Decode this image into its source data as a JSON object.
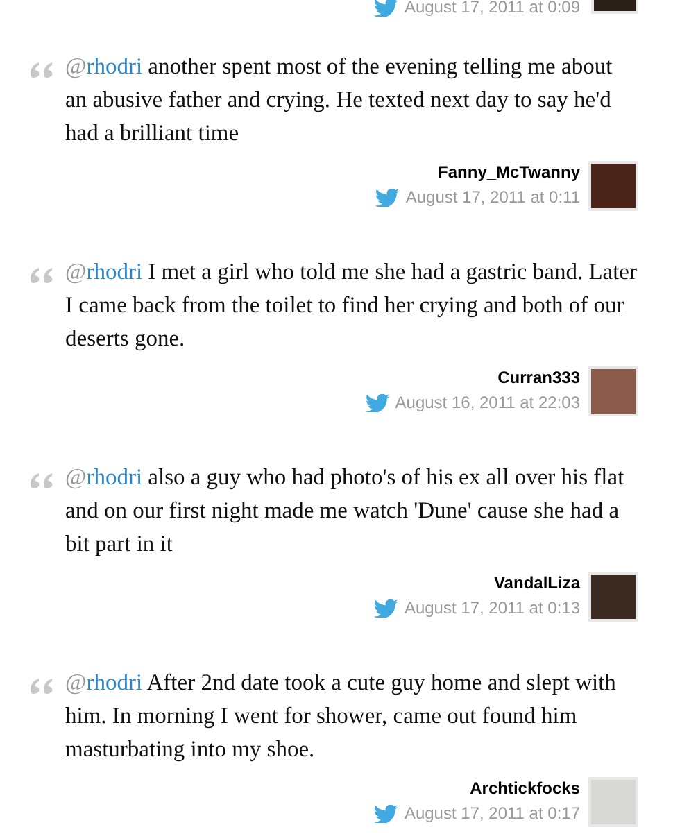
{
  "top_item": {
    "date": "August 17, 2011 at 0:09"
  },
  "tweets": [
    {
      "mention_prefix": "@",
      "mention": "rhodri",
      "text": "another spent most of the evening telling me about an abusive father and crying. He texted next day to say he'd had a brilliant time",
      "author": "Fanny_McTwanny",
      "date": "August 17, 2011 at 0:11",
      "color": "#4a2418"
    },
    {
      "mention_prefix": "@",
      "mention": "rhodri",
      "text": "I met a girl who told me she had a gastric band. Later I came back from the toilet to find her crying and both of our deserts gone.",
      "author": "Curran333",
      "date": "August 16, 2011 at 22:03",
      "color": "#8a5a4a"
    },
    {
      "mention_prefix": "@",
      "mention": "rhodri",
      "text": "also a guy who had photo's of his ex all over his flat and on our first night made me watch 'Dune' cause she had a bit part in it",
      "author": "VandalLiza",
      "date": "August 17, 2011 at 0:13",
      "color": "#3a2a22"
    },
    {
      "mention_prefix": "@",
      "mention": "rhodri",
      "text": "After 2nd date took a cute guy home and slept with him. In morning I went for shower, came out found him masturbating into my shoe.",
      "author": "Archtickfocks",
      "date": "August 17, 2011 at 0:17",
      "color": "#d8d8d4"
    }
  ]
}
